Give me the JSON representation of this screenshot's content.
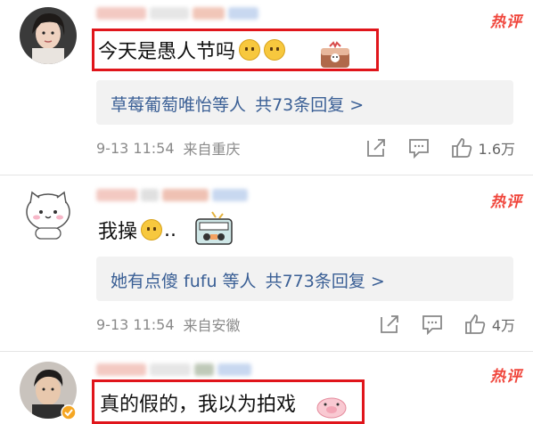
{
  "colors": {
    "hot_badge": "#f0463c",
    "highlight_border": "#e0151b",
    "reply_link": "#3a5f95",
    "meta": "#8a8a8a"
  },
  "comments": [
    {
      "hot_label": "热评",
      "text": "今天是愚人节吗",
      "replies_names": "草莓葡萄唯怡等人",
      "replies_suffix": "共73条回复 >",
      "time": "9-13 11:54",
      "location": "来自重庆",
      "likes": "1.6万",
      "avatar_icon": "woman-avatar-icon"
    },
    {
      "hot_label": "热评",
      "text": "我操",
      "text_suffix": "..",
      "replies_names": "她有点傻 fufu 等人",
      "replies_suffix": "共773条回复 >",
      "time": "9-13 11:54",
      "location": "来自安徽",
      "likes": "4万",
      "avatar_icon": "cute-cat-avatar-icon"
    },
    {
      "hot_label": "热评",
      "text": "真的假的，我以为拍戏",
      "avatar_icon": "man-avatar-icon"
    }
  ]
}
